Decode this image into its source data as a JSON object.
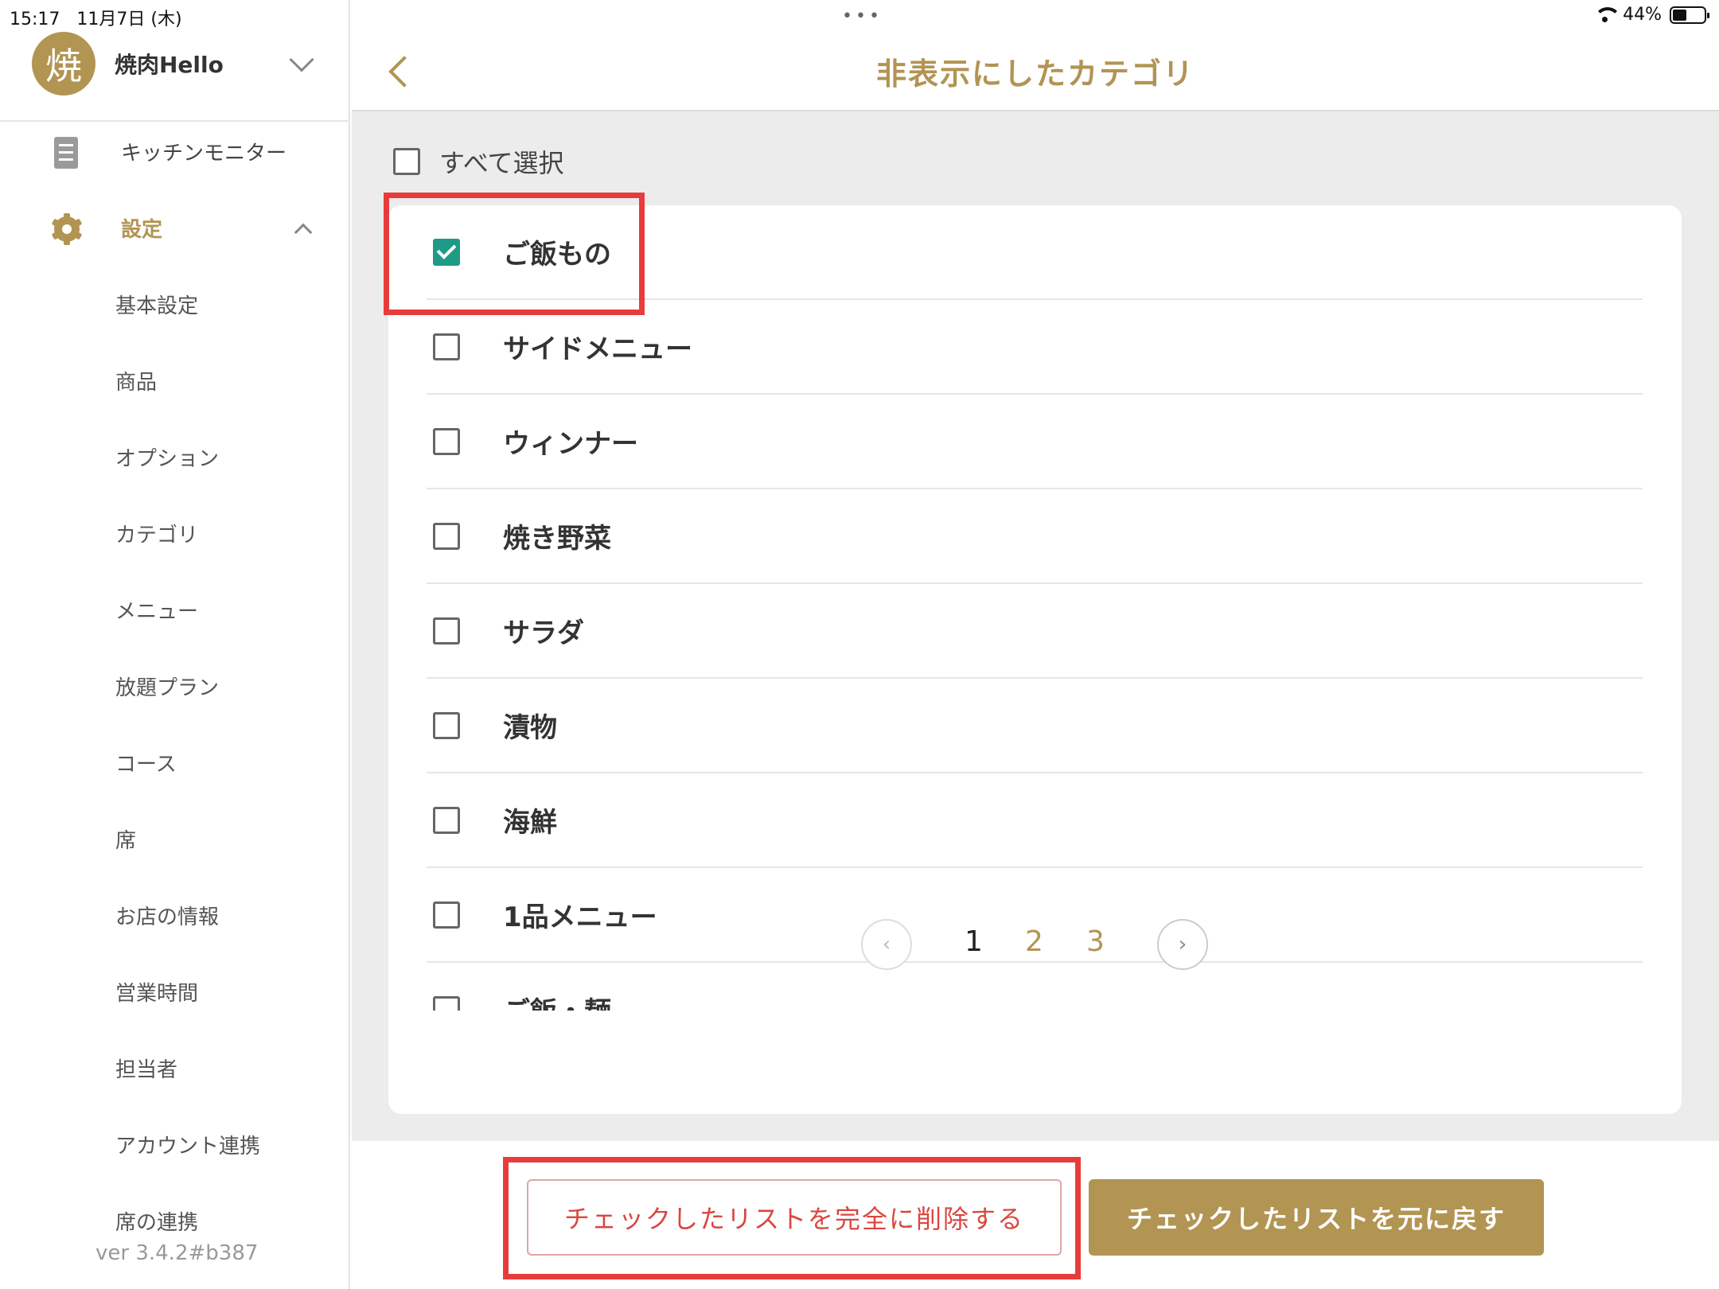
{
  "status": {
    "time": "15:17",
    "date": "11月7日 (木)",
    "battery": "44%"
  },
  "sidebar": {
    "store": {
      "avatar": "焼",
      "name": "焼肉Hello"
    },
    "kitchen_monitor": "キッチンモニター",
    "settings": "設定",
    "items": [
      {
        "label": "基本設定"
      },
      {
        "label": "商品"
      },
      {
        "label": "オプション"
      },
      {
        "label": "カテゴリ"
      },
      {
        "label": "メニュー"
      },
      {
        "label": "放題プラン"
      },
      {
        "label": "コース"
      },
      {
        "label": "席"
      },
      {
        "label": "お店の情報"
      },
      {
        "label": "営業時間"
      },
      {
        "label": "担当者"
      },
      {
        "label": "アカウント連携"
      },
      {
        "label": "席の連携"
      }
    ],
    "version": "ver 3.4.2#b387"
  },
  "header": {
    "title": "非表示にしたカテゴリ"
  },
  "select_all": {
    "label": "すべて選択",
    "checked": false
  },
  "categories": [
    {
      "label": "ご飯もの",
      "checked": true
    },
    {
      "label": "サイドメニュー",
      "checked": false
    },
    {
      "label": "ウィンナー",
      "checked": false
    },
    {
      "label": "焼き野菜",
      "checked": false
    },
    {
      "label": "サラダ",
      "checked": false
    },
    {
      "label": "漬物",
      "checked": false
    },
    {
      "label": "海鮮",
      "checked": false
    },
    {
      "label": "1品メニュー",
      "checked": false
    },
    {
      "label": "ご飯・麺",
      "checked": false
    }
  ],
  "pagination": {
    "pages": [
      "1",
      "2",
      "3"
    ],
    "current": "1",
    "prev": "‹",
    "next": "›"
  },
  "actions": {
    "delete_label": "チェックしたリストを完全に削除する",
    "restore_label": "チェックしたリストを元に戻す"
  },
  "colors": {
    "accent": "#b29453",
    "check": "#1e9b86",
    "danger": "#d9473f",
    "annotation": "#e83c3c"
  }
}
